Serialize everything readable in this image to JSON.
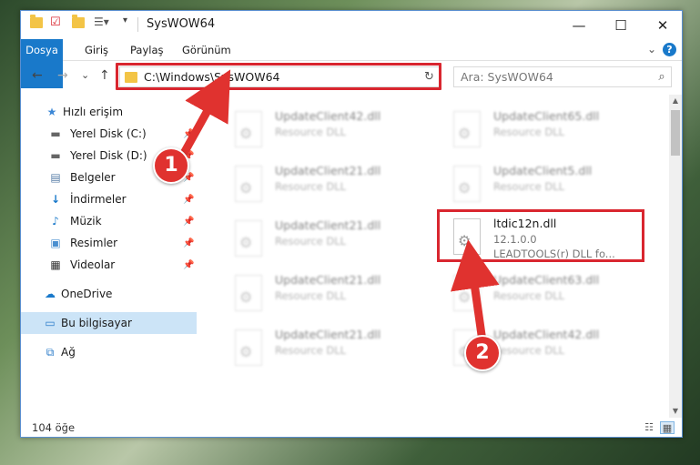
{
  "window": {
    "title": "SysWOW64",
    "controls": {
      "minimize": "—",
      "maximize": "☐",
      "close": "✕"
    }
  },
  "ribbon": {
    "tabs": [
      "Dosya",
      "Giriş",
      "Paylaş",
      "Görünüm"
    ],
    "help": "?"
  },
  "nav": {
    "back": "←",
    "forward": "→",
    "recent": "⌄",
    "up": "↑",
    "address": "C:\\Windows\\SysWOW64",
    "search_placeholder": "Ara: SysWOW64"
  },
  "sidebar": {
    "items": [
      {
        "label": "Hızlı erişim",
        "icon": "star-icon",
        "pinned": false
      },
      {
        "label": "Yerel Disk (C:)",
        "icon": "drive-icon",
        "pinned": true
      },
      {
        "label": "Yerel Disk (D:)",
        "icon": "drive-icon",
        "pinned": true
      },
      {
        "label": "Belgeler",
        "icon": "document-icon",
        "pinned": true
      },
      {
        "label": "İndirmeler",
        "icon": "download-icon",
        "pinned": true
      },
      {
        "label": "Müzik",
        "icon": "music-icon",
        "pinned": true
      },
      {
        "label": "Resimler",
        "icon": "pictures-icon",
        "pinned": true
      },
      {
        "label": "Videolar",
        "icon": "video-icon",
        "pinned": true
      },
      {
        "label": "OneDrive",
        "icon": "cloud-icon",
        "pinned": false
      },
      {
        "label": "Bu bilgisayar",
        "icon": "computer-icon",
        "pinned": false
      },
      {
        "label": "Ağ",
        "icon": "network-icon",
        "pinned": false
      }
    ]
  },
  "files": [
    {
      "name": "UpdateClient42.dll",
      "line2": "Resource DLL",
      "line3": ""
    },
    {
      "name": "UpdateClient65.dll",
      "line2": "Resource DLL",
      "line3": ""
    },
    {
      "name": "UpdateClient21.dll",
      "line2": "Resource DLL",
      "line3": ""
    },
    {
      "name": "UpdateClient5.dll",
      "line2": "Resource DLL",
      "line3": ""
    },
    {
      "name": "UpdateClient21.dll",
      "line2": "Resource DLL",
      "line3": ""
    },
    {
      "name": "ltdic12n.dll",
      "line2": "12.1.0.0",
      "line3": "LEADTOOLS(r) DLL fo..."
    },
    {
      "name": "UpdateClient21.dll",
      "line2": "Resource DLL",
      "line3": ""
    },
    {
      "name": "UpdateClient63.dll",
      "line2": "Resource DLL",
      "line3": ""
    },
    {
      "name": "UpdateClient21.dll",
      "line2": "Resource DLL",
      "line3": ""
    },
    {
      "name": "UpdateClient42.dll",
      "line2": "Resource DLL",
      "line3": ""
    }
  ],
  "status": {
    "count": "104 öğe"
  },
  "annotations": {
    "step1": "1",
    "step2": "2"
  },
  "colors": {
    "accent": "#1979ca",
    "highlight": "#d9262f",
    "badge": "#e0322f"
  }
}
